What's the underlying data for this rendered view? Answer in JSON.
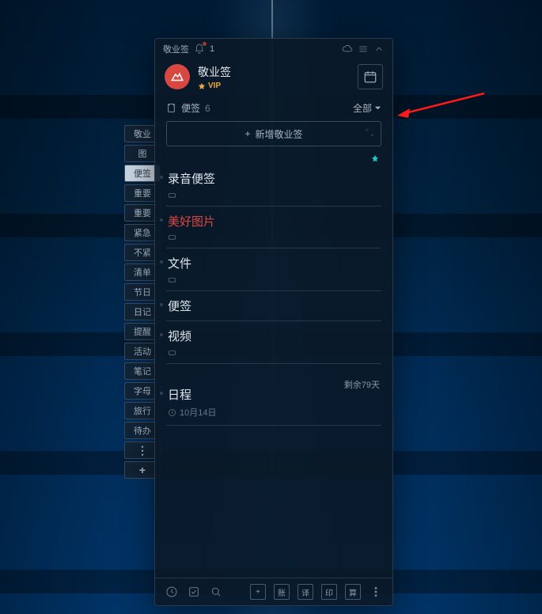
{
  "titlebar": {
    "app_name": "敬业签",
    "notif_count": "1"
  },
  "brand": {
    "name": "敬业签",
    "vip": "VIP"
  },
  "section": {
    "label": "便签",
    "count": "6"
  },
  "filter": {
    "label": "全部"
  },
  "add_button": {
    "label": "新增敬业签"
  },
  "items": [
    {
      "title": "录音便签",
      "meta_kind": "storage"
    },
    {
      "title": "美好图片",
      "meta_kind": "storage",
      "red": true
    },
    {
      "title": "文件",
      "meta_kind": "storage"
    },
    {
      "title": "便签"
    },
    {
      "title": "视频",
      "meta_kind": "storage"
    },
    {
      "title": "日程",
      "meta_kind": "clock",
      "meta_text": "10月14日",
      "tag": "剩余79天",
      "gap_before": true
    }
  ],
  "side_tabs": [
    "敬业",
    "图",
    "便签",
    "重要",
    "重要",
    "紧急",
    "不紧",
    "清单",
    "节日",
    "日记",
    "提醒",
    "活动",
    "笔记",
    "字母",
    "旅行",
    "待办"
  ],
  "side_active_index": 2,
  "footer_boxes": [
    "账",
    "译",
    "印",
    "算"
  ]
}
